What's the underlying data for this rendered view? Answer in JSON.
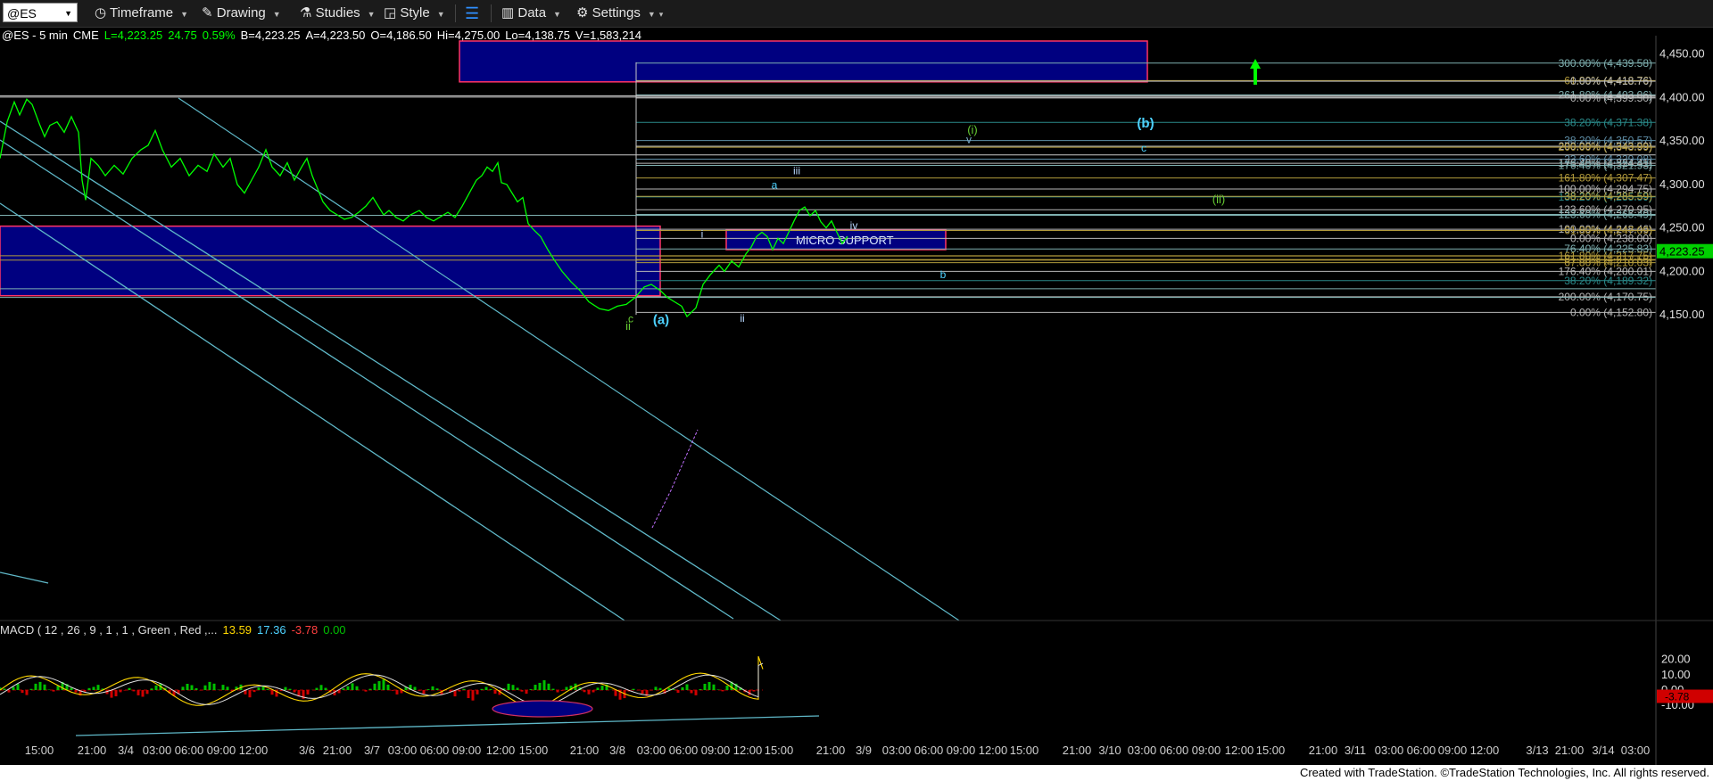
{
  "toolbar": {
    "symbol": "@ES",
    "items": [
      "Timeframe",
      "Drawing",
      "Studies",
      "Style",
      "Data",
      "Settings"
    ]
  },
  "info": {
    "symbol_label": "@ES - 5 min",
    "exchange": "CME",
    "last": "L=4,223.25",
    "change": "24.75",
    "change_pct": "0.59%",
    "bid": "B=4,223.25",
    "ask": "A=4,223.50",
    "open": "O=4,186.50",
    "high": "Hi=4,275.00",
    "low": "Lo=4,138.75",
    "volume": "V=1,583,214"
  },
  "macd": {
    "label": "MACD ( 12 , 26 , 9 , 1 , 1 , Green , Red ,...",
    "values": [
      "13.59",
      "17.36",
      "-3.78",
      "0.00"
    ]
  },
  "colors": {
    "price": "#00ff00",
    "box_fill": "#000080",
    "box_border": "#ff3366",
    "fib": "#7fb0b0",
    "fib_gold": "#b39b3c",
    "channel": "#5fb8c8"
  },
  "chart_data": {
    "type": "line",
    "price_ylim": [
      4130,
      4465
    ],
    "price_ticks": [
      "4,450.00",
      "4,400.00",
      "4,350.00",
      "4,300.00",
      "4,250.00",
      "4,200.00",
      "4,150.00"
    ],
    "last_price": "4,223.25",
    "macd_ticks": [
      "20.00",
      "10.00",
      "0.00",
      "-10.00"
    ],
    "macd_last": "-3.78",
    "x_ticks": [
      "15:00",
      "21:00",
      "3/4",
      "03:00",
      "06:00",
      "09:00",
      "12:00",
      "3/6",
      "21:00",
      "3/7",
      "03:00",
      "06:00",
      "09:00",
      "12:00",
      "15:00",
      "21:00",
      "3/8",
      "03:00",
      "06:00",
      "09:00",
      "12:00",
      "15:00",
      "21:00",
      "3/9",
      "03:00",
      "06:00",
      "09:00",
      "12:00",
      "15:00",
      "21:00",
      "3/10",
      "03:00",
      "06:00",
      "09:00",
      "12:00",
      "15:00",
      "21:00",
      "3/11",
      "03:00",
      "06:00",
      "09:00",
      "12:00",
      "3/13",
      "21:00",
      "3/14",
      "03:00"
    ],
    "fib_levels": [
      {
        "label": "300.00% (4,439.58)",
        "price": 4439.58,
        "color": "#7fb0b0"
      },
      {
        "label": "61.80% (4,418.76)",
        "price": 4419.5,
        "color": "#b39b3c"
      },
      {
        "label": "0.00% (4,418.76)",
        "price": 4418.76,
        "color": "#b8b8b8"
      },
      {
        "label": "261.80% (4,403.06)",
        "price": 4403.06,
        "color": "#7fb0b0"
      },
      {
        "label": "0.00% (4,399.50)",
        "price": 4399.5,
        "color": "#b8b8b8"
      },
      {
        "label": "38.20% (4,371.38)",
        "price": 4371.38,
        "color": "#2a8a8a"
      },
      {
        "label": "38.20% (4,350.57)",
        "price": 4350.57,
        "color": "#5f8fa8"
      },
      {
        "label": "200.00% (4,343.99)",
        "price": 4343.99,
        "color": "#b8b8b8"
      },
      {
        "label": "200.00% (4,343.99)",
        "price": 4342.8,
        "color": "#b39b3c"
      },
      {
        "label": "23.60% (4,329.08)",
        "price": 4329.08,
        "color": "#5f8fa8"
      },
      {
        "label": "176.40% (4,324.41)",
        "price": 4324.41,
        "color": "#b8b8b8"
      },
      {
        "label": "176.40% (4,321.93)",
        "price": 4321.93,
        "color": "#7fb0b0"
      },
      {
        "label": "161.80% (4,307.47)",
        "price": 4307.47,
        "color": "#b39b3c"
      },
      {
        "label": "100.00% (4,294.75)",
        "price": 4294.75,
        "color": "#b8b8b8"
      },
      {
        "label": "138.20% (4,285.59)",
        "price": 4285.59,
        "color": "#2a8a8a"
      },
      {
        "label": "38.20% (4,285.59)",
        "price": 4286.3,
        "color": "#b39b3c"
      },
      {
        "label": "123.60% (4,270.95)",
        "price": 4270.95,
        "color": "#b8b8b8"
      },
      {
        "label": "123.60% (4,265.49)",
        "price": 4265.49,
        "color": "#7fb0b0"
      },
      {
        "label": "100.00% (4,248.46)",
        "price": 4248.46,
        "color": "#b8b8b8"
      },
      {
        "label": "61.80% (4,247.09)",
        "price": 4247.09,
        "color": "#b39b3c"
      },
      {
        "label": "0.00% (4,238.00)",
        "price": 4238.0,
        "color": "#b8b8b8"
      },
      {
        "label": "76.40% (4,225.83)",
        "price": 4225.83,
        "color": "#7fb0b0"
      },
      {
        "label": "161.80% (4,217.75)",
        "price": 4217.75,
        "color": "#b39b3c"
      },
      {
        "label": "61.80% (4,213.56)",
        "price": 4213.56,
        "color": "#b39b3c"
      },
      {
        "label": "67.80% (4,210.03)",
        "price": 4210.03,
        "color": "#b39b3c"
      },
      {
        "label": "176.40% (4,200.01)",
        "price": 4200.01,
        "color": "#b8b8b8"
      },
      {
        "label": "38.20% (4,189.32)",
        "price": 4189.32,
        "color": "#2a8a8a"
      },
      {
        "label": "200.00% (4,170.75)",
        "price": 4170.75,
        "color": "#b8b8b8"
      },
      {
        "label": "0.00% (4,152.80)",
        "price": 4152.8,
        "color": "#b8b8b8"
      }
    ],
    "zones": [
      {
        "x0": 515,
        "x1": 1286,
        "p0": 4465,
        "p1": 4418
      },
      {
        "x0": 0,
        "x1": 740,
        "p0": 4252,
        "p1": 4172
      },
      {
        "x0": 814,
        "x1": 1060,
        "p0": 4248,
        "p1": 4225,
        "label": "MICRO SUPPORT"
      }
    ],
    "price_path": [
      [
        0,
        4330
      ],
      [
        8,
        4372
      ],
      [
        16,
        4395
      ],
      [
        22,
        4380
      ],
      [
        30,
        4398
      ],
      [
        36,
        4392
      ],
      [
        44,
        4370
      ],
      [
        50,
        4355
      ],
      [
        56,
        4368
      ],
      [
        64,
        4372
      ],
      [
        72,
        4360
      ],
      [
        80,
        4378
      ],
      [
        88,
        4360
      ],
      [
        92,
        4305
      ],
      [
        96,
        4282
      ],
      [
        102,
        4330
      ],
      [
        110,
        4322
      ],
      [
        118,
        4310
      ],
      [
        128,
        4322
      ],
      [
        138,
        4312
      ],
      [
        148,
        4330
      ],
      [
        158,
        4340
      ],
      [
        166,
        4345
      ],
      [
        174,
        4362
      ],
      [
        182,
        4340
      ],
      [
        192,
        4320
      ],
      [
        202,
        4330
      ],
      [
        212,
        4310
      ],
      [
        222,
        4322
      ],
      [
        232,
        4315
      ],
      [
        240,
        4335
      ],
      [
        250,
        4320
      ],
      [
        258,
        4330
      ],
      [
        266,
        4300
      ],
      [
        274,
        4290
      ],
      [
        282,
        4305
      ],
      [
        290,
        4320
      ],
      [
        298,
        4340
      ],
      [
        305,
        4320
      ],
      [
        314,
        4310
      ],
      [
        322,
        4325
      ],
      [
        330,
        4305
      ],
      [
        338,
        4320
      ],
      [
        344,
        4330
      ],
      [
        350,
        4310
      ],
      [
        356,
        4295
      ],
      [
        362,
        4280
      ],
      [
        370,
        4270
      ],
      [
        378,
        4265
      ],
      [
        386,
        4260
      ],
      [
        394,
        4262
      ],
      [
        402,
        4268
      ],
      [
        410,
        4275
      ],
      [
        418,
        4285
      ],
      [
        424,
        4275
      ],
      [
        430,
        4265
      ],
      [
        436,
        4270
      ],
      [
        444,
        4262
      ],
      [
        452,
        4258
      ],
      [
        460,
        4265
      ],
      [
        470,
        4270
      ],
      [
        478,
        4262
      ],
      [
        486,
        4258
      ],
      [
        494,
        4263
      ],
      [
        502,
        4268
      ],
      [
        510,
        4262
      ],
      [
        518,
        4275
      ],
      [
        526,
        4290
      ],
      [
        534,
        4305
      ],
      [
        540,
        4310
      ],
      [
        546,
        4320
      ],
      [
        552,
        4315
      ],
      [
        558,
        4325
      ],
      [
        562,
        4302
      ],
      [
        568,
        4300
      ],
      [
        574,
        4290
      ],
      [
        580,
        4280
      ],
      [
        586,
        4285
      ],
      [
        592,
        4255
      ],
      [
        598,
        4248
      ],
      [
        606,
        4240
      ],
      [
        614,
        4225
      ],
      [
        622,
        4212
      ],
      [
        630,
        4200
      ],
      [
        640,
        4188
      ],
      [
        650,
        4178
      ],
      [
        660,
        4165
      ],
      [
        672,
        4157
      ],
      [
        682,
        4155
      ],
      [
        692,
        4160
      ],
      [
        702,
        4162
      ],
      [
        712,
        4170
      ],
      [
        722,
        4182
      ],
      [
        730,
        4185
      ],
      [
        740,
        4178
      ],
      [
        748,
        4170
      ],
      [
        756,
        4165
      ],
      [
        764,
        4160
      ],
      [
        770,
        4148
      ],
      [
        780,
        4158
      ],
      [
        788,
        4185
      ],
      [
        796,
        4196
      ],
      [
        806,
        4207
      ],
      [
        812,
        4200
      ],
      [
        820,
        4212
      ],
      [
        828,
        4205
      ],
      [
        836,
        4220
      ],
      [
        842,
        4228
      ],
      [
        848,
        4240
      ],
      [
        854,
        4245
      ],
      [
        860,
        4240
      ],
      [
        866,
        4225
      ],
      [
        872,
        4238
      ],
      [
        878,
        4232
      ],
      [
        884,
        4245
      ],
      [
        890,
        4258
      ],
      [
        896,
        4270
      ],
      [
        902,
        4274
      ],
      [
        908,
        4264
      ],
      [
        914,
        4270
      ],
      [
        920,
        4257
      ],
      [
        926,
        4250
      ],
      [
        932,
        4258
      ],
      [
        938,
        4245
      ],
      [
        944,
        4232
      ],
      [
        950,
        4240
      ]
    ],
    "labels": [
      {
        "text": "(b)",
        "price": 4370.5,
        "color": "#4dd2ff",
        "size": 15,
        "bold": true
      },
      {
        "text": "(i)",
        "price": 4363.5,
        "color": "#66cc33",
        "size": 13
      },
      {
        "text": "v",
        "price": 4352.5,
        "color": "#7fb0d0",
        "size": 12
      },
      {
        "text": "c",
        "price": 4342.8,
        "color": "#4dd2ff",
        "size": 12
      },
      {
        "text": "iii",
        "price": 4316.8,
        "color": "#b8d8ff",
        "size": 12
      },
      {
        "text": "a",
        "price": 4300.5,
        "color": "#4dd2ff",
        "size": 12
      },
      {
        "text": "(ii)",
        "price": 4283.5,
        "color": "#66cc33",
        "size": 13
      },
      {
        "text": "iv",
        "price": 4253.5,
        "color": "#b8d8ff",
        "size": 12
      },
      {
        "text": "i",
        "price": 4244.2,
        "color": "#b8d8ff",
        "size": 12
      },
      {
        "text": "b",
        "price": 4197.5,
        "color": "#4dd2ff",
        "size": 12
      },
      {
        "text": "ii",
        "price": 4146.8,
        "color": "#b8d8ff",
        "size": 12
      },
      {
        "text": "c",
        "price": 4146.5,
        "color": "#66cc33",
        "size": 12
      },
      {
        "text": "(a)",
        "price": 4144.5,
        "color": "#4dd2ff",
        "size": 15,
        "bold": true
      },
      {
        "text": "ii",
        "price": 4137.8,
        "color": "#66cc33",
        "size": 13
      }
    ]
  }
}
